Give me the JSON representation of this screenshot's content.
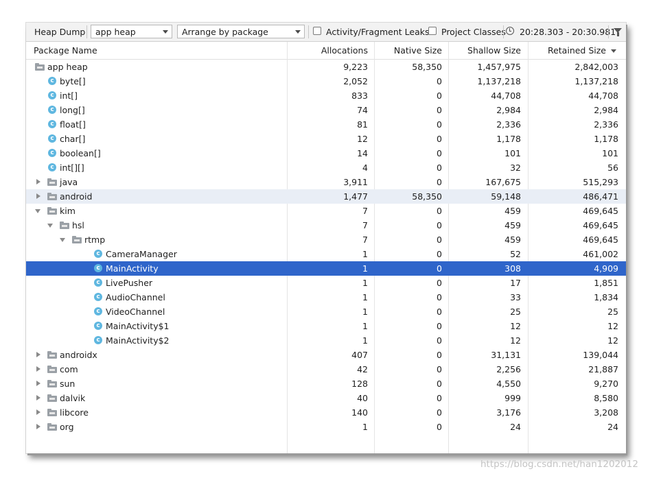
{
  "toolbar": {
    "heap_dump_label": "Heap Dump",
    "heap_select": "app heap",
    "arrange_select": "Arrange by package",
    "leaks_checkbox_label": "Activity/Fragment Leaks",
    "project_classes_label": "Project Classes",
    "time_range": "20:28.303 - 20:30.981",
    "icons": [
      "clock-icon",
      "filter-icon"
    ]
  },
  "table": {
    "headers": {
      "name": "Package Name",
      "allocations": "Allocations",
      "native_size": "Native Size",
      "shallow_size": "Shallow Size",
      "retained_size": "Retained Size"
    },
    "sorted_column": "Retained Size",
    "rows": [
      {
        "name": "app heap",
        "alloc": "9,223",
        "native": "58,350",
        "shallow": "1,457,975",
        "retained": "2,842,003"
      },
      {
        "name": "byte[]",
        "alloc": "2,052",
        "native": "0",
        "shallow": "1,137,218",
        "retained": "1,137,218"
      },
      {
        "name": "int[]",
        "alloc": "833",
        "native": "0",
        "shallow": "44,708",
        "retained": "44,708"
      },
      {
        "name": "long[]",
        "alloc": "74",
        "native": "0",
        "shallow": "2,984",
        "retained": "2,984"
      },
      {
        "name": "float[]",
        "alloc": "81",
        "native": "0",
        "shallow": "2,336",
        "retained": "2,336"
      },
      {
        "name": "char[]",
        "alloc": "12",
        "native": "0",
        "shallow": "1,178",
        "retained": "1,178"
      },
      {
        "name": "boolean[]",
        "alloc": "14",
        "native": "0",
        "shallow": "101",
        "retained": "101"
      },
      {
        "name": "int[][]",
        "alloc": "4",
        "native": "0",
        "shallow": "32",
        "retained": "56"
      },
      {
        "name": "java",
        "alloc": "3,911",
        "native": "0",
        "shallow": "167,675",
        "retained": "515,293"
      },
      {
        "name": "android",
        "alloc": "1,477",
        "native": "58,350",
        "shallow": "59,148",
        "retained": "486,471"
      },
      {
        "name": "kim",
        "alloc": "7",
        "native": "0",
        "shallow": "459",
        "retained": "469,645"
      },
      {
        "name": "hsl",
        "alloc": "7",
        "native": "0",
        "shallow": "459",
        "retained": "469,645"
      },
      {
        "name": "rtmp",
        "alloc": "7",
        "native": "0",
        "shallow": "459",
        "retained": "469,645"
      },
      {
        "name": "CameraManager",
        "alloc": "1",
        "native": "0",
        "shallow": "52",
        "retained": "461,002"
      },
      {
        "name": "MainActivity",
        "alloc": "1",
        "native": "0",
        "shallow": "308",
        "retained": "4,909"
      },
      {
        "name": "LivePusher",
        "alloc": "1",
        "native": "0",
        "shallow": "17",
        "retained": "1,851"
      },
      {
        "name": "AudioChannel",
        "alloc": "1",
        "native": "0",
        "shallow": "33",
        "retained": "1,834"
      },
      {
        "name": "VideoChannel",
        "alloc": "1",
        "native": "0",
        "shallow": "25",
        "retained": "25"
      },
      {
        "name": "MainActivity$1",
        "alloc": "1",
        "native": "0",
        "shallow": "12",
        "retained": "12"
      },
      {
        "name": "MainActivity$2",
        "alloc": "1",
        "native": "0",
        "shallow": "12",
        "retained": "12"
      },
      {
        "name": "androidx",
        "alloc": "407",
        "native": "0",
        "shallow": "31,131",
        "retained": "139,044"
      },
      {
        "name": "com",
        "alloc": "42",
        "native": "0",
        "shallow": "2,256",
        "retained": "21,887"
      },
      {
        "name": "sun",
        "alloc": "128",
        "native": "0",
        "shallow": "4,550",
        "retained": "9,270"
      },
      {
        "name": "dalvik",
        "alloc": "40",
        "native": "0",
        "shallow": "999",
        "retained": "8,580"
      },
      {
        "name": "libcore",
        "alloc": "140",
        "native": "0",
        "shallow": "3,176",
        "retained": "3,208"
      },
      {
        "name": "org",
        "alloc": "1",
        "native": "0",
        "shallow": "24",
        "retained": "24"
      }
    ],
    "selected_row": "MainActivity",
    "hover_row": "android"
  },
  "colors": {
    "selection": "#2f65ca",
    "hover": "#e9eef6",
    "class_icon": "#5fb7e0",
    "folder_icon": "#9aa0a6"
  },
  "watermark": "https://blog.csdn.net/han1202012"
}
